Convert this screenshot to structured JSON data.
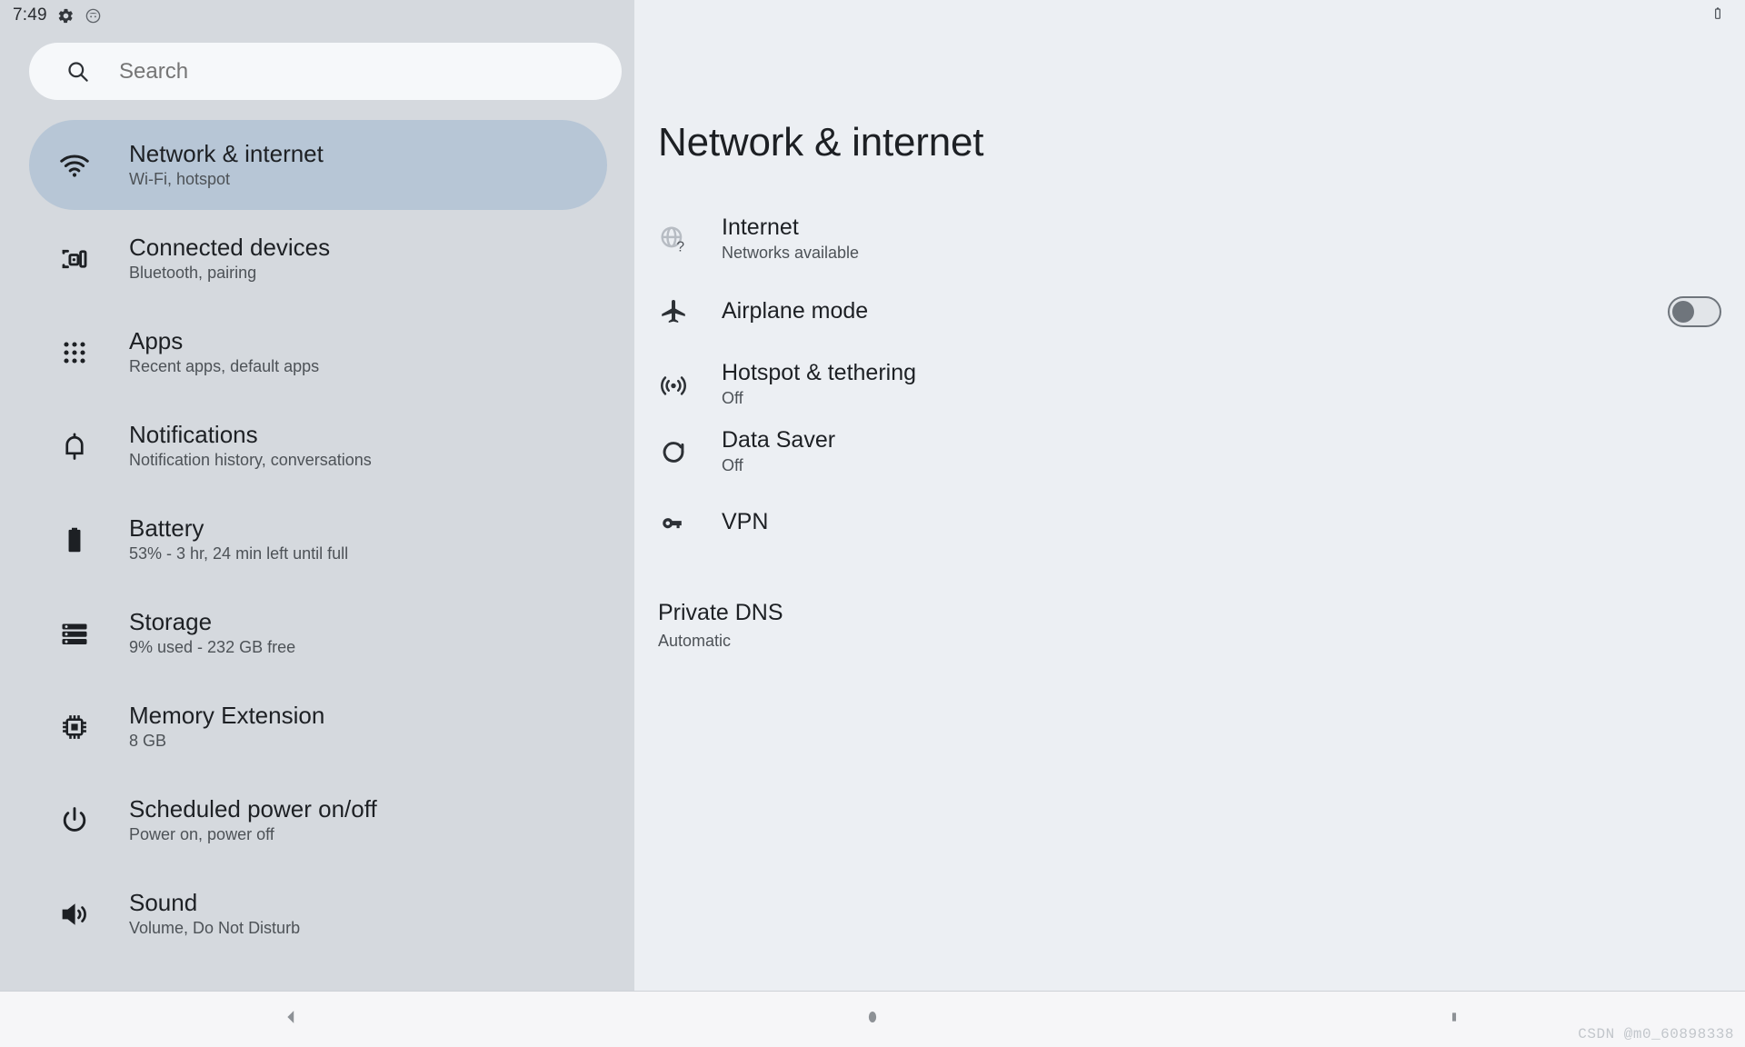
{
  "statusbar": {
    "time": "7:49",
    "icons": [
      "gear-icon",
      "face-icon"
    ],
    "right_icon": "battery-icon"
  },
  "search": {
    "placeholder": "Search",
    "value": "",
    "icon": "search-icon"
  },
  "sidebar": {
    "items": [
      {
        "icon": "wifi-icon",
        "label": "Network & internet",
        "sub": "Wi-Fi, hotspot",
        "selected": true
      },
      {
        "icon": "devices-icon",
        "label": "Connected devices",
        "sub": "Bluetooth, pairing",
        "selected": false
      },
      {
        "icon": "apps-grid-icon",
        "label": "Apps",
        "sub": "Recent apps, default apps",
        "selected": false
      },
      {
        "icon": "bell-icon",
        "label": "Notifications",
        "sub": "Notification history, conversations",
        "selected": false
      },
      {
        "icon": "battery-icon",
        "label": "Battery",
        "sub": "53% - 3 hr, 24 min left until full",
        "selected": false
      },
      {
        "icon": "storage-icon",
        "label": "Storage",
        "sub": "9% used - 232 GB free",
        "selected": false
      },
      {
        "icon": "chip-icon",
        "label": "Memory Extension",
        "sub": "8 GB",
        "selected": false
      },
      {
        "icon": "power-icon",
        "label": "Scheduled power on/off",
        "sub": "Power on, power off",
        "selected": false
      },
      {
        "icon": "volume-icon",
        "label": "Sound",
        "sub": "Volume, Do Not Disturb",
        "selected": false
      }
    ]
  },
  "main": {
    "title": "Network & internet",
    "rows": [
      {
        "icon": "globe-question-icon",
        "title": "Internet",
        "sub": "Networks available",
        "toggle": null
      },
      {
        "icon": "airplane-icon",
        "title": "Airplane mode",
        "sub": "",
        "toggle": "off"
      },
      {
        "icon": "hotspot-icon",
        "title": "Hotspot & tethering",
        "sub": "Off",
        "toggle": null
      },
      {
        "icon": "data-saver-icon",
        "title": "Data Saver",
        "sub": "Off",
        "toggle": null
      },
      {
        "icon": "key-icon",
        "title": "VPN",
        "sub": "",
        "toggle": null
      }
    ],
    "private_dns": {
      "title": "Private DNS",
      "value": "Automatic"
    }
  },
  "navbar": {
    "back": "back-triangle-icon",
    "home": "home-circle-icon",
    "recents": "recents-square-icon"
  },
  "watermark": "CSDN @m0_60898338",
  "colors": {
    "sidebar_bg": "#d5d9de",
    "main_bg": "#eceff3",
    "selected_item": "#b7c6d6",
    "search_bg": "#f6f8fa",
    "text_primary": "#1d2024",
    "text_secondary": "#4d5257",
    "toggle_off": "#6f757c",
    "navbar_bg": "#f6f6f8"
  }
}
